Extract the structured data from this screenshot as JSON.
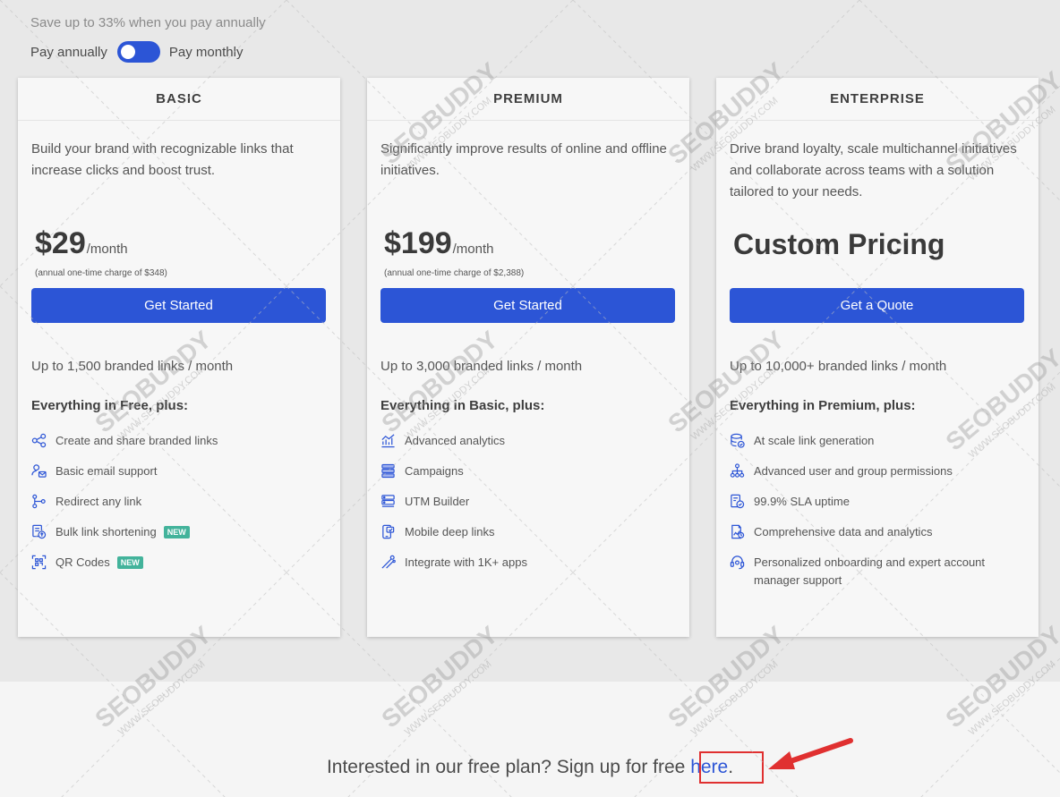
{
  "billing": {
    "save_text": "Save up to 33% when you pay annually",
    "annually_label": "Pay annually",
    "monthly_label": "Pay monthly"
  },
  "plans": [
    {
      "name": "BASIC",
      "description": "Build your brand with recognizable links that increase clicks and boost trust.",
      "price": "$29",
      "period": "/month",
      "annual_note": "(annual one-time charge of $348)",
      "cta": "Get Started",
      "limit": "Up to 1,500 branded links / month",
      "plus": "Everything in Free, plus:",
      "features": [
        {
          "text": "Create and share branded links",
          "icon": "share-icon",
          "badge": ""
        },
        {
          "text": "Basic email support",
          "icon": "email-support-icon",
          "badge": ""
        },
        {
          "text": "Redirect any link",
          "icon": "redirect-icon",
          "badge": ""
        },
        {
          "text": "Bulk link shortening",
          "icon": "bulk-link-icon",
          "badge": "NEW"
        },
        {
          "text": "QR Codes",
          "icon": "qr-code-icon",
          "badge": "NEW"
        }
      ]
    },
    {
      "name": "PREMIUM",
      "description": "Significantly improve results of online and offline initiatives.",
      "price": "$199",
      "period": "/month",
      "annual_note": "(annual one-time charge of $2,388)",
      "cta": "Get Started",
      "limit": "Up to 3,000 branded links / month",
      "plus": "Everything in Basic, plus:",
      "features": [
        {
          "text": "Advanced analytics",
          "icon": "analytics-icon"
        },
        {
          "text": "Campaigns",
          "icon": "campaigns-icon"
        },
        {
          "text": "UTM Builder",
          "icon": "utm-builder-icon"
        },
        {
          "text": "Mobile deep links",
          "icon": "mobile-link-icon"
        },
        {
          "text": "Integrate with 1K+ apps",
          "icon": "integrations-icon"
        }
      ]
    },
    {
      "name": "ENTERPRISE",
      "description": "Drive brand loyalty, scale multichannel initiatives and collaborate across teams with a solution tailored to your needs.",
      "custom_price": "Custom Pricing",
      "cta": "Get a Quote",
      "limit": "Up to 10,000+ branded links / month",
      "plus": "Everything in Premium, plus:",
      "features": [
        {
          "text": "At scale link generation",
          "icon": "database-icon"
        },
        {
          "text": "Advanced user and group permissions",
          "icon": "permissions-icon"
        },
        {
          "text": "99.9% SLA uptime",
          "icon": "uptime-icon"
        },
        {
          "text": "Comprehensive data and analytics",
          "icon": "data-report-icon"
        },
        {
          "text": "Personalized onboarding and expert account manager support",
          "icon": "headset-icon"
        }
      ]
    }
  ],
  "free_plan": {
    "text": "Interested in our free plan? Sign up for free ",
    "link": "here",
    "suffix": "."
  },
  "watermark": {
    "brand": "SEOBUDDY",
    "domain": "WWW.SEOBUDDY.COM"
  },
  "colors": {
    "accent": "#2c55d6",
    "badge": "#43b39b",
    "highlight": "#e03030"
  }
}
